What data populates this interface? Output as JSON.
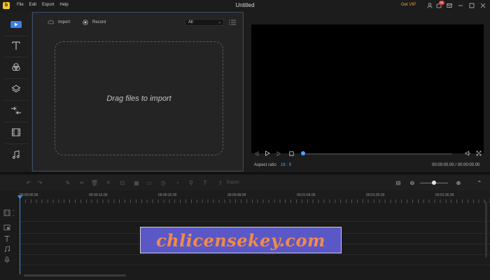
{
  "window": {
    "title": "Untitled",
    "logo_glyph": "b"
  },
  "menu": [
    "File",
    "Edit",
    "Export",
    "Help"
  ],
  "titlebar": {
    "getvip": "Get VIP",
    "notification_count": "99"
  },
  "sidebar": {
    "items": [
      "media-icon",
      "text-icon",
      "filters-icon",
      "overlays-icon",
      "transitions-icon",
      "elements-icon",
      "music-icon"
    ]
  },
  "media": {
    "import_label": "Import",
    "record_label": "Record",
    "filter_value": "All",
    "dropzone_text": "Drag files to import"
  },
  "preview": {
    "aspect_label": "Aspect ratio",
    "aspect_value": "16 : 9",
    "timecode": "00:00:00.00 / 00:00:00.00",
    "progress": 0
  },
  "timeline": {
    "export_label": "Export",
    "ruler_labels": [
      "00:00:00.00",
      "00:00:16.00",
      "00:00:32.00",
      "00:00:48.00",
      "00:01:04.00",
      "00:01:20.00",
      "00:01:36.00"
    ]
  },
  "watermark": "chlicensekey.com",
  "colors": {
    "accent": "#4aa3ff",
    "vip": "#f2a33a",
    "panel_border": "#3a4d6a"
  }
}
